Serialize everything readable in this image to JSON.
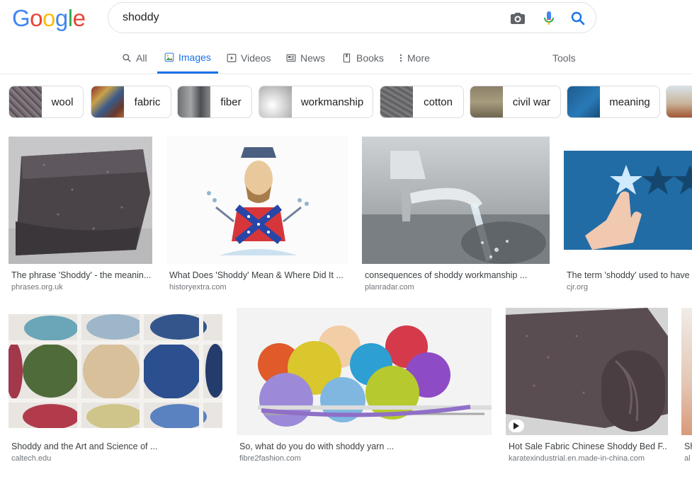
{
  "logo": "Google",
  "search": {
    "query": "shoddy"
  },
  "tabs": [
    {
      "label": "All",
      "icon": "search-icon"
    },
    {
      "label": "Images",
      "icon": "image-icon"
    },
    {
      "label": "Videos",
      "icon": "video-icon"
    },
    {
      "label": "News",
      "icon": "news-icon"
    },
    {
      "label": "Books",
      "icon": "book-icon"
    },
    {
      "label": "More",
      "icon": "more-dots-icon"
    }
  ],
  "tools_label": "Tools",
  "chips": [
    {
      "label": "wool"
    },
    {
      "label": "fabric"
    },
    {
      "label": "fiber"
    },
    {
      "label": "workmanship"
    },
    {
      "label": "cotton"
    },
    {
      "label": "civil war"
    },
    {
      "label": "meaning"
    }
  ],
  "results": [
    {
      "title": "The phrase 'Shoddy' - the meanin...",
      "source": "phrases.org.uk"
    },
    {
      "title": "What Does 'Shoddy' Mean & Where Did It ...",
      "source": "historyextra.com"
    },
    {
      "title": "consequences of shoddy workmanship ...",
      "source": "planradar.com"
    },
    {
      "title": "The term 'shoddy' used to have a",
      "source": "cjr.org"
    },
    {
      "title": "Shoddy and the Art and Science of ...",
      "source": "caltech.edu"
    },
    {
      "title": "So, what do you do with shoddy yarn ...",
      "source": "fibre2fashion.com"
    },
    {
      "title": "Hot Sale Fabric Chinese Shoddy Bed F...",
      "source": "karatexindustrial.en.made-in-china.com"
    },
    {
      "title": "Sh",
      "source": "al"
    }
  ],
  "colors": {
    "accent": "#1a73e8",
    "google_blue": "#4285f4",
    "google_red": "#ea4335",
    "google_yellow": "#fbbc05",
    "google_green": "#34a853"
  }
}
